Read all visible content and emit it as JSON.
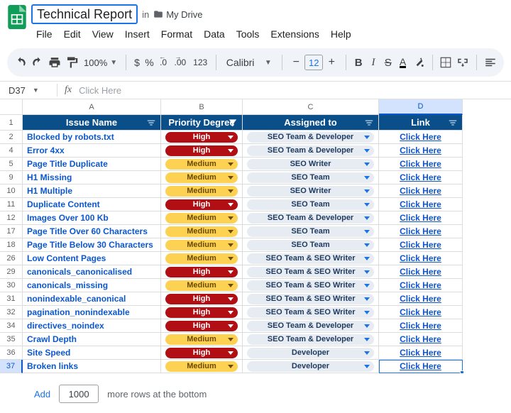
{
  "doc": {
    "title": "Technical Report",
    "in_label": "in",
    "folder": "My Drive"
  },
  "menu": [
    "File",
    "Edit",
    "View",
    "Insert",
    "Format",
    "Data",
    "Tools",
    "Extensions",
    "Help"
  ],
  "toolbar": {
    "zoom": "100%",
    "decimal_dec": ".0",
    "decimal_inc": ".00",
    "numfmt": "123",
    "font": "Calibri",
    "fontsize": "12"
  },
  "fx": {
    "namebox": "D37",
    "placeholder": "Click Here"
  },
  "columns": [
    "A",
    "B",
    "C",
    "D"
  ],
  "headers": {
    "issue": "Issue Name",
    "priority": "Priority Degree",
    "assigned": "Assigned to",
    "link": "Link"
  },
  "link_text": "Click Here",
  "rows": [
    {
      "n": "1",
      "header": true
    },
    {
      "n": "2",
      "issue": "Blocked by robots.txt",
      "priority": "High",
      "assigned": "SEO Team & Developer"
    },
    {
      "n": "4",
      "issue": "Error 4xx",
      "priority": "High",
      "assigned": "SEO Team & Developer"
    },
    {
      "n": "5",
      "issue": "Page Title Duplicate",
      "priority": "Medium",
      "assigned": "SEO Writer"
    },
    {
      "n": "9",
      "issue": "H1 Missing",
      "priority": "Medium",
      "assigned": "SEO Team"
    },
    {
      "n": "10",
      "issue": "H1 Multiple",
      "priority": "Medium",
      "assigned": "SEO Writer"
    },
    {
      "n": "11",
      "issue": "Duplicate Content",
      "priority": "High",
      "assigned": "SEO Team"
    },
    {
      "n": "12",
      "issue": "Images Over 100 Kb",
      "priority": "Medium",
      "assigned": "SEO Team & Developer"
    },
    {
      "n": "17",
      "issue": "Page Title Over 60 Characters",
      "priority": "Medium",
      "assigned": "SEO Team"
    },
    {
      "n": "18",
      "issue": "Page Title Below 30 Characters",
      "priority": "Medium",
      "assigned": "SEO Team"
    },
    {
      "n": "26",
      "issue": "Low Content Pages",
      "priority": "Medium",
      "assigned": "SEO Team & SEO Writer"
    },
    {
      "n": "29",
      "issue": "canonicals_canonicalised",
      "priority": "High",
      "assigned": "SEO Team & SEO Writer"
    },
    {
      "n": "30",
      "issue": "canonicals_missing",
      "priority": "Medium",
      "assigned": "SEO Team & SEO Writer"
    },
    {
      "n": "31",
      "issue": "nonindexable_canonical",
      "priority": "High",
      "assigned": "SEO Team & SEO Writer"
    },
    {
      "n": "32",
      "issue": "pagination_nonindexable",
      "priority": "High",
      "assigned": "SEO Team & SEO Writer"
    },
    {
      "n": "34",
      "issue": "directives_noindex",
      "priority": "High",
      "assigned": "SEO Team & Developer"
    },
    {
      "n": "35",
      "issue": "Crawl Depth",
      "priority": "Medium",
      "assigned": "SEO Team & Developer"
    },
    {
      "n": "36",
      "issue": "Site Speed",
      "priority": "High",
      "assigned": "Developer"
    },
    {
      "n": "37",
      "issue": "Broken links",
      "priority": "Medium",
      "assigned": "Developer",
      "selected": true
    }
  ],
  "footer": {
    "add": "Add",
    "count": "1000",
    "more": "more rows at the bottom"
  }
}
